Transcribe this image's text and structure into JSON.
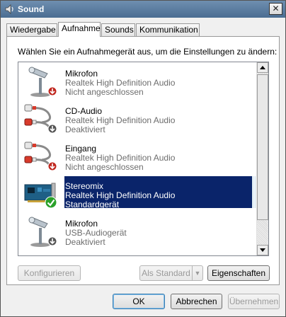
{
  "window": {
    "title": "Sound",
    "close_label": "✕"
  },
  "tabs": [
    {
      "label": "Wiedergabe"
    },
    {
      "label": "Aufnahme"
    },
    {
      "label": "Sounds"
    },
    {
      "label": "Kommunikation"
    }
  ],
  "instruction": "Wählen Sie ein Aufnahmegerät aus, um die Einstellungen zu ändern:",
  "devices": [
    {
      "name": "Mikrofon",
      "driver": "Realtek High Definition Audio",
      "status": "Nicht angeschlossen",
      "icon": "microphone-icon",
      "badge": "red-down-arrow"
    },
    {
      "name": "CD-Audio",
      "driver": "Realtek High Definition Audio",
      "status": "Deaktiviert",
      "icon": "rca-cable-icon",
      "badge": "gray-down-arrow"
    },
    {
      "name": "Eingang",
      "driver": "Realtek High Definition Audio",
      "status": "Nicht angeschlossen",
      "icon": "rca-cable-icon",
      "badge": "red-down-arrow"
    },
    {
      "name": "Stereomix",
      "driver": "Realtek High Definition Audio",
      "status": "Standardgerät",
      "icon": "sound-card-icon",
      "badge": "green-check"
    },
    {
      "name": "Mikrofon",
      "driver": "USB-Audiogerät",
      "status": "Deaktiviert",
      "icon": "microphone-icon",
      "badge": "gray-down-arrow"
    }
  ],
  "buttons": {
    "configure": "Konfigurieren",
    "set_default": "Als Standard",
    "properties": "Eigenschaften",
    "ok": "OK",
    "cancel": "Abbrechen",
    "apply": "Übernehmen"
  },
  "colors": {
    "selection": "#0a246a",
    "check_green": "#2aa12a",
    "badge_red": "#c0271f"
  }
}
